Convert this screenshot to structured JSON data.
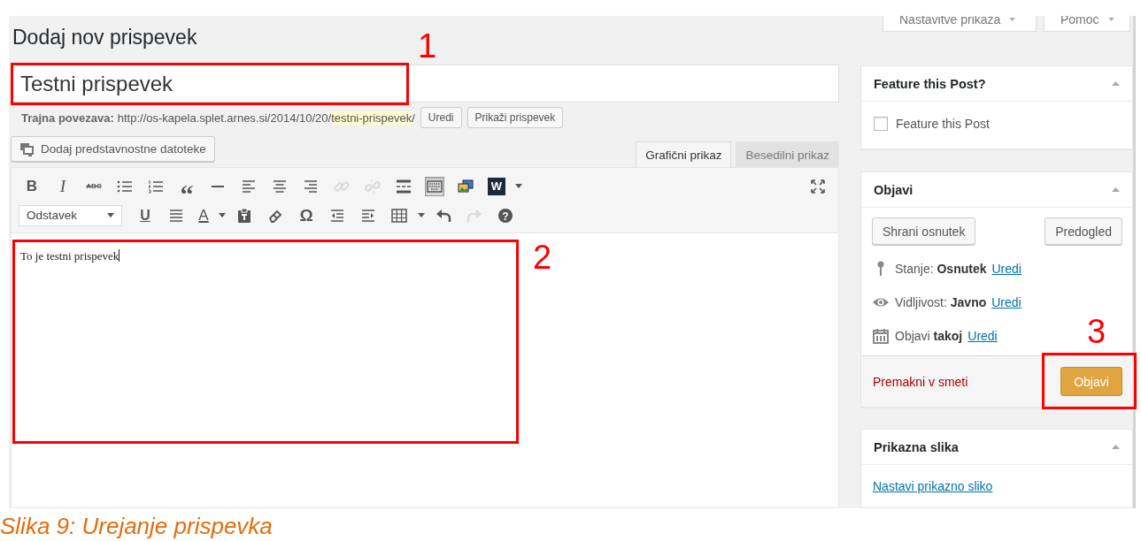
{
  "page_title": "Dodaj nov prispevek",
  "screen_options": [
    {
      "label": "Nastavitve prikaza"
    },
    {
      "label": "Pomoč"
    }
  ],
  "title_field": {
    "value": "Testni prispevek"
  },
  "permalink": {
    "label": "Trajna povezava:",
    "url_base": "http://os-kapela.splet.arnes.si/2014/10/20/",
    "slug": "testni-prispevek",
    "url_end": "/",
    "buttons": [
      "Uredi",
      "Prikaži prispevek"
    ]
  },
  "add_media_button": "Dodaj predstavnostne datoteke",
  "editor_tabs": [
    {
      "label": "Grafični prikaz",
      "selected": true
    },
    {
      "label": "Besedilni prikaz",
      "selected": false
    }
  ],
  "toolbar_rows": [
    [
      {
        "kind": "bold",
        "text": "B",
        "on": false,
        "disabled": false
      },
      {
        "kind": "italic",
        "text": "I",
        "on": false,
        "disabled": false
      },
      {
        "kind": "strike",
        "text": "ABC",
        "on": false,
        "disabled": false
      },
      {
        "kind": "ul",
        "on": false,
        "disabled": false
      },
      {
        "kind": "ol",
        "on": false,
        "disabled": false
      },
      {
        "kind": "quote",
        "text": "“",
        "on": false,
        "disabled": false
      },
      {
        "kind": "hr",
        "on": false,
        "disabled": false
      },
      {
        "kind": "alignleft",
        "on": false,
        "disabled": false
      },
      {
        "kind": "aligncenter",
        "on": false,
        "disabled": false
      },
      {
        "kind": "alignright",
        "on": false,
        "disabled": false
      },
      {
        "kind": "link",
        "on": false,
        "disabled": true
      },
      {
        "kind": "unlink",
        "on": false,
        "disabled": true
      },
      {
        "kind": "more",
        "on": false,
        "disabled": false
      },
      {
        "kind": "toggle",
        "on": true,
        "disabled": false
      },
      {
        "kind": "media",
        "on": false,
        "disabled": false
      },
      {
        "kind": "wlogo",
        "text": "W",
        "on": false,
        "disabled": false
      },
      {
        "kind": "caret",
        "on": false,
        "disabled": false
      },
      {
        "kind": "fullscreen",
        "on": false,
        "disabled": false
      }
    ],
    [
      {
        "kind": "select",
        "text": "Odstavek",
        "on": false,
        "disabled": false
      },
      {
        "kind": "underline",
        "text": "U",
        "on": false,
        "disabled": false
      },
      {
        "kind": "justify",
        "on": false,
        "disabled": false
      },
      {
        "kind": "textcolor",
        "text": "A",
        "on": false,
        "disabled": false
      },
      {
        "kind": "caret",
        "on": false,
        "disabled": false
      },
      {
        "kind": "paste",
        "on": false,
        "disabled": false
      },
      {
        "kind": "eraser",
        "on": false,
        "disabled": false
      },
      {
        "kind": "omega",
        "text": "Ω",
        "on": false,
        "disabled": false
      },
      {
        "kind": "outdent",
        "on": false,
        "disabled": false
      },
      {
        "kind": "indent",
        "on": false,
        "disabled": false
      },
      {
        "kind": "table",
        "on": false,
        "disabled": false
      },
      {
        "kind": "caret",
        "on": false,
        "disabled": false
      },
      {
        "kind": "undo",
        "on": false,
        "disabled": false
      },
      {
        "kind": "redo",
        "on": false,
        "disabled": true
      },
      {
        "kind": "help",
        "text": "?",
        "on": false,
        "disabled": false
      }
    ]
  ],
  "content": "To je testni prispevek",
  "sidebar": {
    "feature_box": {
      "title": "Feature this Post?",
      "checkbox": {
        "label": "Feature this Post",
        "checked": false
      }
    },
    "publish_box": {
      "title": "Objavi",
      "buttons": [
        "Shrani osnutek",
        "Predogled"
      ],
      "meta": [
        {
          "kind": "status",
          "text": "Stanje: **Osnutek**",
          "link": "Uredi"
        },
        {
          "kind": "visibility",
          "text": "Vidljivost: **Javno**",
          "link": "Uredi"
        },
        {
          "kind": "schedule",
          "text": "Objavi **takoj**",
          "link": "Uredi"
        }
      ],
      "trash_link": "Premakni v smeti",
      "publish_button": "Objavi"
    },
    "featured_image_box": {
      "title": "Prikazna slika",
      "link": "Nastavi prikazno sliko"
    }
  },
  "annotations": [
    {
      "number": "1"
    },
    {
      "number": "2"
    },
    {
      "number": "3"
    }
  ],
  "caption": "Slika 9: Urejanje prispevka"
}
